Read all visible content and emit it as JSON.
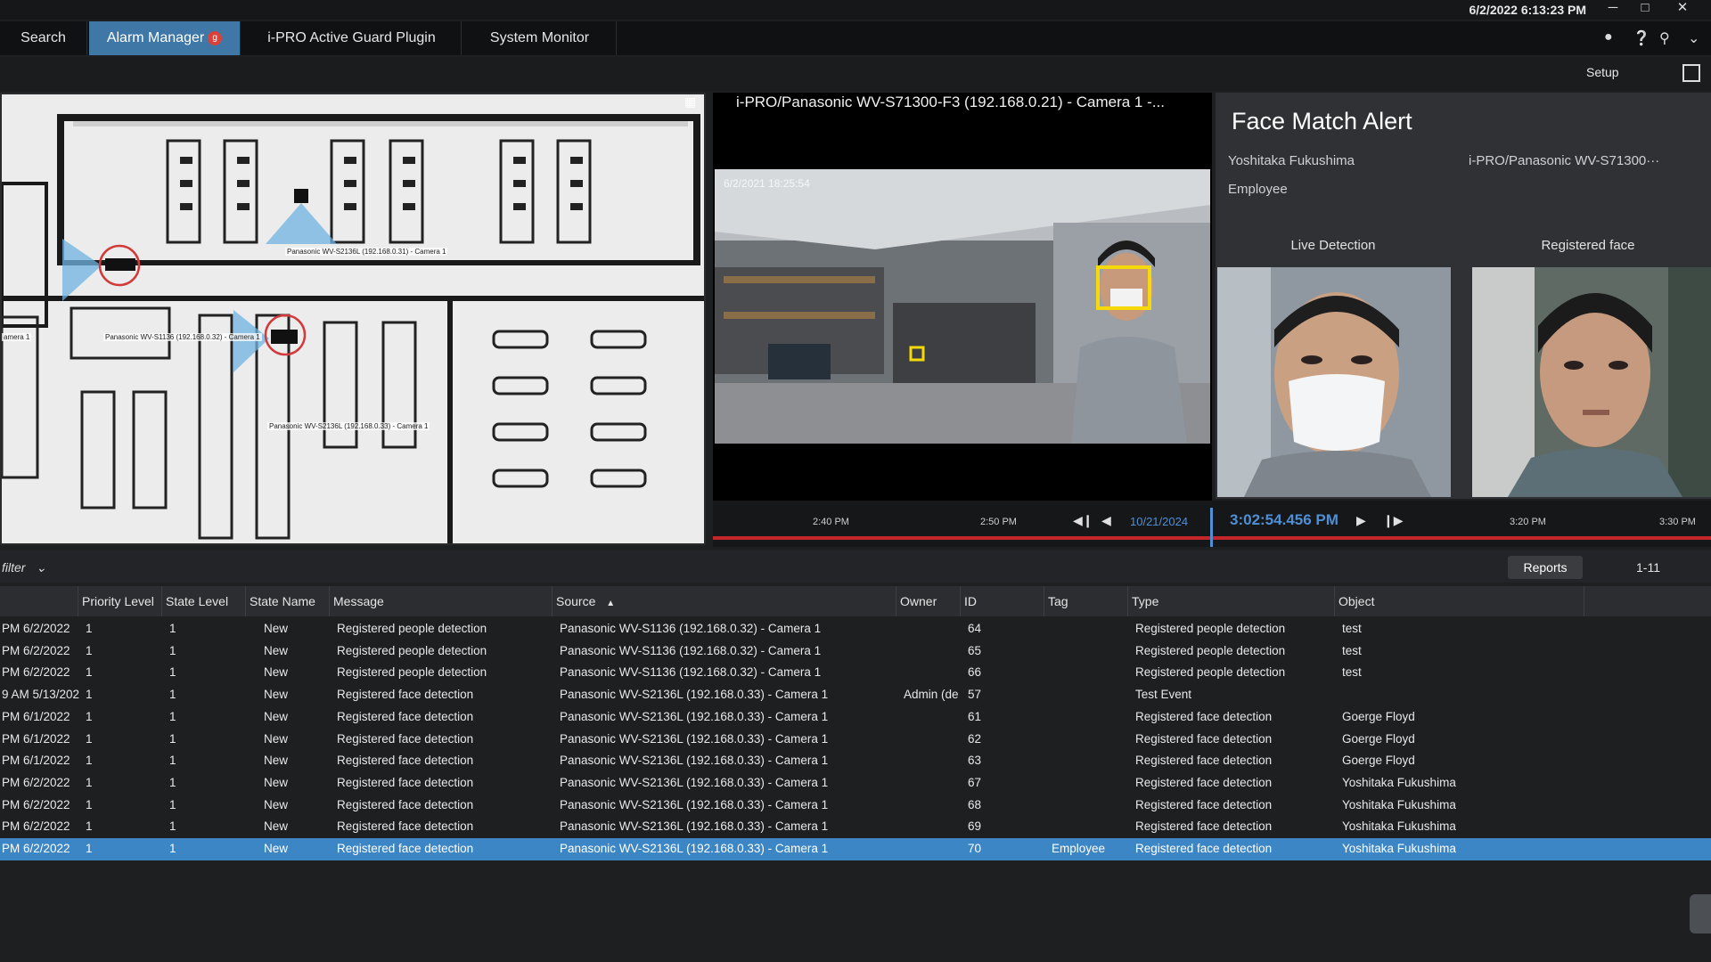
{
  "titlebar": {
    "clock": "6/2/2022 6:13:23 PM"
  },
  "tabs": [
    {
      "label": "Search"
    },
    {
      "label": "Alarm Manager",
      "badge": "g"
    },
    {
      "label": "i-PRO Active Guard Plugin"
    },
    {
      "label": "System Monitor"
    }
  ],
  "toolbar": {
    "setup_label": "Setup"
  },
  "map": {
    "cameras": [
      {
        "label": "Panasonic WV-S2136L (192.168.0.31) - Camera 1"
      },
      {
        "label": "Panasonic WV-S1136 (192.168.0.32) - Camera 1"
      },
      {
        "label": "Panasonic WV-S2136L (192.168.0.33) - Camera 1"
      },
      {
        "label": "amera 1"
      }
    ]
  },
  "video": {
    "title": "i-PRO/Panasonic WV-S71300-F3 (192.168.0.21) - Camera 1 -...",
    "overlay_timestamp": "6/2/2021 18:25:54"
  },
  "alert": {
    "title": "Face Match Alert",
    "person_name": "Yoshitaka Fukushima",
    "source": "i-PRO/Panasonic WV-S71300···",
    "tag": "Employee",
    "live_label": "Live Detection",
    "registered_label": "Registered face"
  },
  "timeline": {
    "ticks": [
      "2:40 PM",
      "2:50 PM",
      "3:20 PM",
      "3:30 PM"
    ],
    "date": "10/21/2024",
    "current_time": "3:02:54.456 PM"
  },
  "table_toolbar": {
    "filter_label": "filter",
    "reports_label": "Reports",
    "range": "1-11"
  },
  "table": {
    "columns": [
      "",
      "Priority Level",
      "State Level",
      "State Name",
      "Message",
      "Source",
      "Owner",
      "ID",
      "Tag",
      "Type",
      "Object"
    ],
    "rows": [
      [
        "PM 6/2/2022",
        "1",
        "1",
        "New",
        "Registered people detection",
        "Panasonic WV-S1136 (192.168.0.32) - Camera 1",
        "",
        "64",
        "",
        "Registered people detection",
        "test"
      ],
      [
        "PM 6/2/2022",
        "1",
        "1",
        "New",
        "Registered people detection",
        "Panasonic WV-S1136 (192.168.0.32) - Camera 1",
        "",
        "65",
        "",
        "Registered people detection",
        "test"
      ],
      [
        "PM 6/2/2022",
        "1",
        "1",
        "New",
        "Registered people detection",
        "Panasonic WV-S1136 (192.168.0.32) - Camera 1",
        "",
        "66",
        "",
        "Registered people detection",
        "test"
      ],
      [
        "9 AM 5/13/202",
        "1",
        "1",
        "New",
        "Registered face detection",
        "Panasonic WV-S2136L (192.168.0.33) - Camera 1",
        "Admin (de",
        "57",
        "",
        "Test Event",
        ""
      ],
      [
        "PM 6/1/2022",
        "1",
        "1",
        "New",
        "Registered face detection",
        "Panasonic WV-S2136L (192.168.0.33) - Camera 1",
        "",
        "61",
        "",
        "Registered face detection",
        "Goerge Floyd"
      ],
      [
        "PM 6/1/2022",
        "1",
        "1",
        "New",
        "Registered face detection",
        "Panasonic WV-S2136L (192.168.0.33) - Camera 1",
        "",
        "62",
        "",
        "Registered face detection",
        "Goerge Floyd"
      ],
      [
        "PM 6/1/2022",
        "1",
        "1",
        "New",
        "Registered face detection",
        "Panasonic WV-S2136L (192.168.0.33) - Camera 1",
        "",
        "63",
        "",
        "Registered face detection",
        "Goerge Floyd"
      ],
      [
        "PM 6/2/2022",
        "1",
        "1",
        "New",
        "Registered face detection",
        "Panasonic WV-S2136L (192.168.0.33) - Camera 1",
        "",
        "67",
        "",
        "Registered face detection",
        "Yoshitaka Fukushima"
      ],
      [
        "PM 6/2/2022",
        "1",
        "1",
        "New",
        "Registered face detection",
        "Panasonic WV-S2136L (192.168.0.33) - Camera 1",
        "",
        "68",
        "",
        "Registered face detection",
        "Yoshitaka Fukushima"
      ],
      [
        "PM 6/2/2022",
        "1",
        "1",
        "New",
        "Registered face detection",
        "Panasonic WV-S2136L (192.168.0.33) - Camera 1",
        "",
        "69",
        "",
        "Registered face detection",
        "Yoshitaka Fukushima"
      ],
      [
        "PM 6/2/2022",
        "1",
        "1",
        "New",
        "Registered face detection",
        "Panasonic WV-S2136L (192.168.0.33) - Camera 1",
        "",
        "70",
        "Employee",
        "Registered face detection",
        "Yoshitaka Fukushima"
      ]
    ],
    "selected_row": 10
  }
}
